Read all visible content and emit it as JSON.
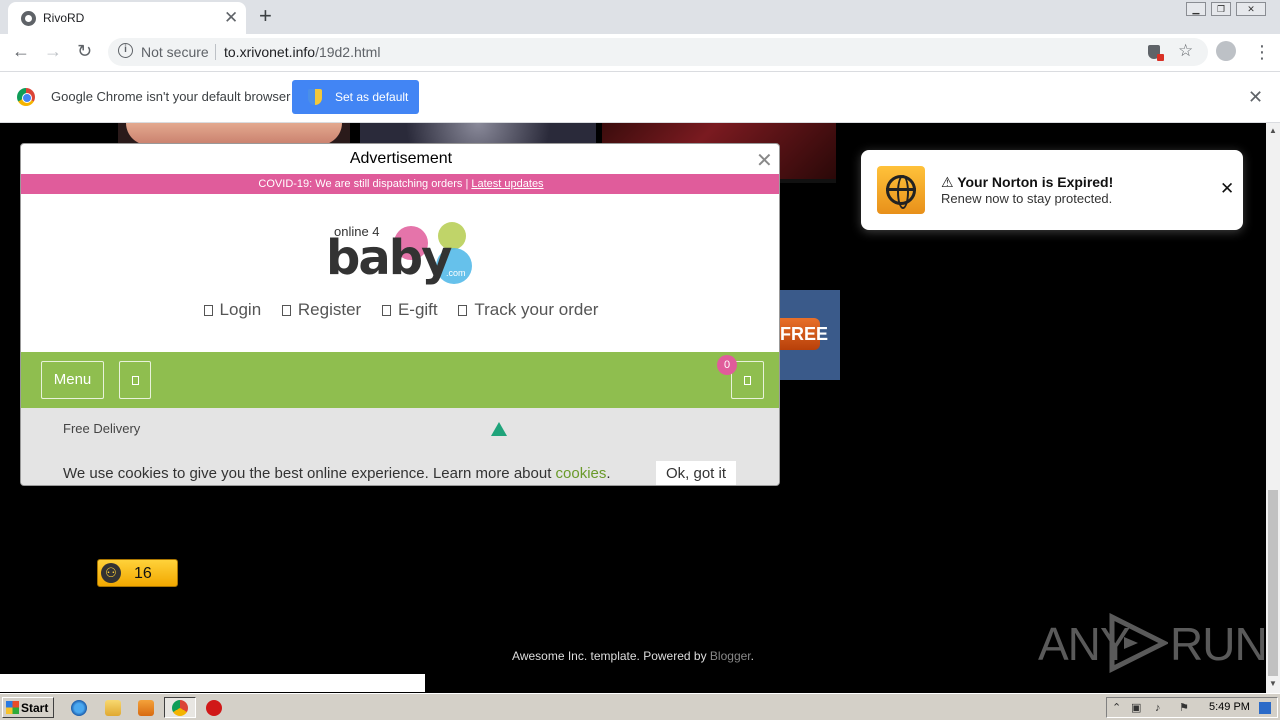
{
  "browser": {
    "tab_title": "RivoRD",
    "tab_close": "✕",
    "new_tab": "+",
    "url_security": "Not secure",
    "url_host": "to.xrivonet.info",
    "url_path": "/19d2.html",
    "window_controls": [
      "minimize",
      "restore",
      "close"
    ]
  },
  "infobar": {
    "message": "Google Chrome isn't your default browser",
    "button_label": "Set as default",
    "close": "✕"
  },
  "ad": {
    "title": "Advertisement",
    "close": "✕",
    "covid_text": "COVID-19: We are still dispatching orders | ",
    "covid_link": "Latest updates",
    "logo_small": "online 4",
    "logo_big": "baby",
    "logo_suffix": ".com",
    "nav": [
      "Login",
      "Register",
      "E-gift",
      "Track your order"
    ],
    "menu_label": "Menu",
    "cart_count": "0",
    "free_delivery": "Free Delivery",
    "cookie_text": "We use cookies to give you the best online experience. Learn more about ",
    "cookie_link": "cookies",
    "cookie_end": ".",
    "cookie_button": "Ok, got it"
  },
  "norton": {
    "title": "⚠ Your Norton is Expired!",
    "subtitle": "Renew now to stay protected.",
    "close": "✕"
  },
  "page": {
    "free_banner": "FREE",
    "badge_count": "16",
    "footer_text": "Awesome Inc. template. Powered by ",
    "footer_link": "Blogger",
    "footer_end": ".",
    "watermark_a": "ANY",
    "watermark_b": "RUN"
  },
  "taskbar": {
    "start_label": "Start",
    "clock": "5:49 PM"
  },
  "colors": {
    "accent_pink": "#e05c9b",
    "accent_green": "#8fbe4f",
    "chrome_blue": "#4285f4",
    "norton_yellow": "#ffc23a"
  }
}
